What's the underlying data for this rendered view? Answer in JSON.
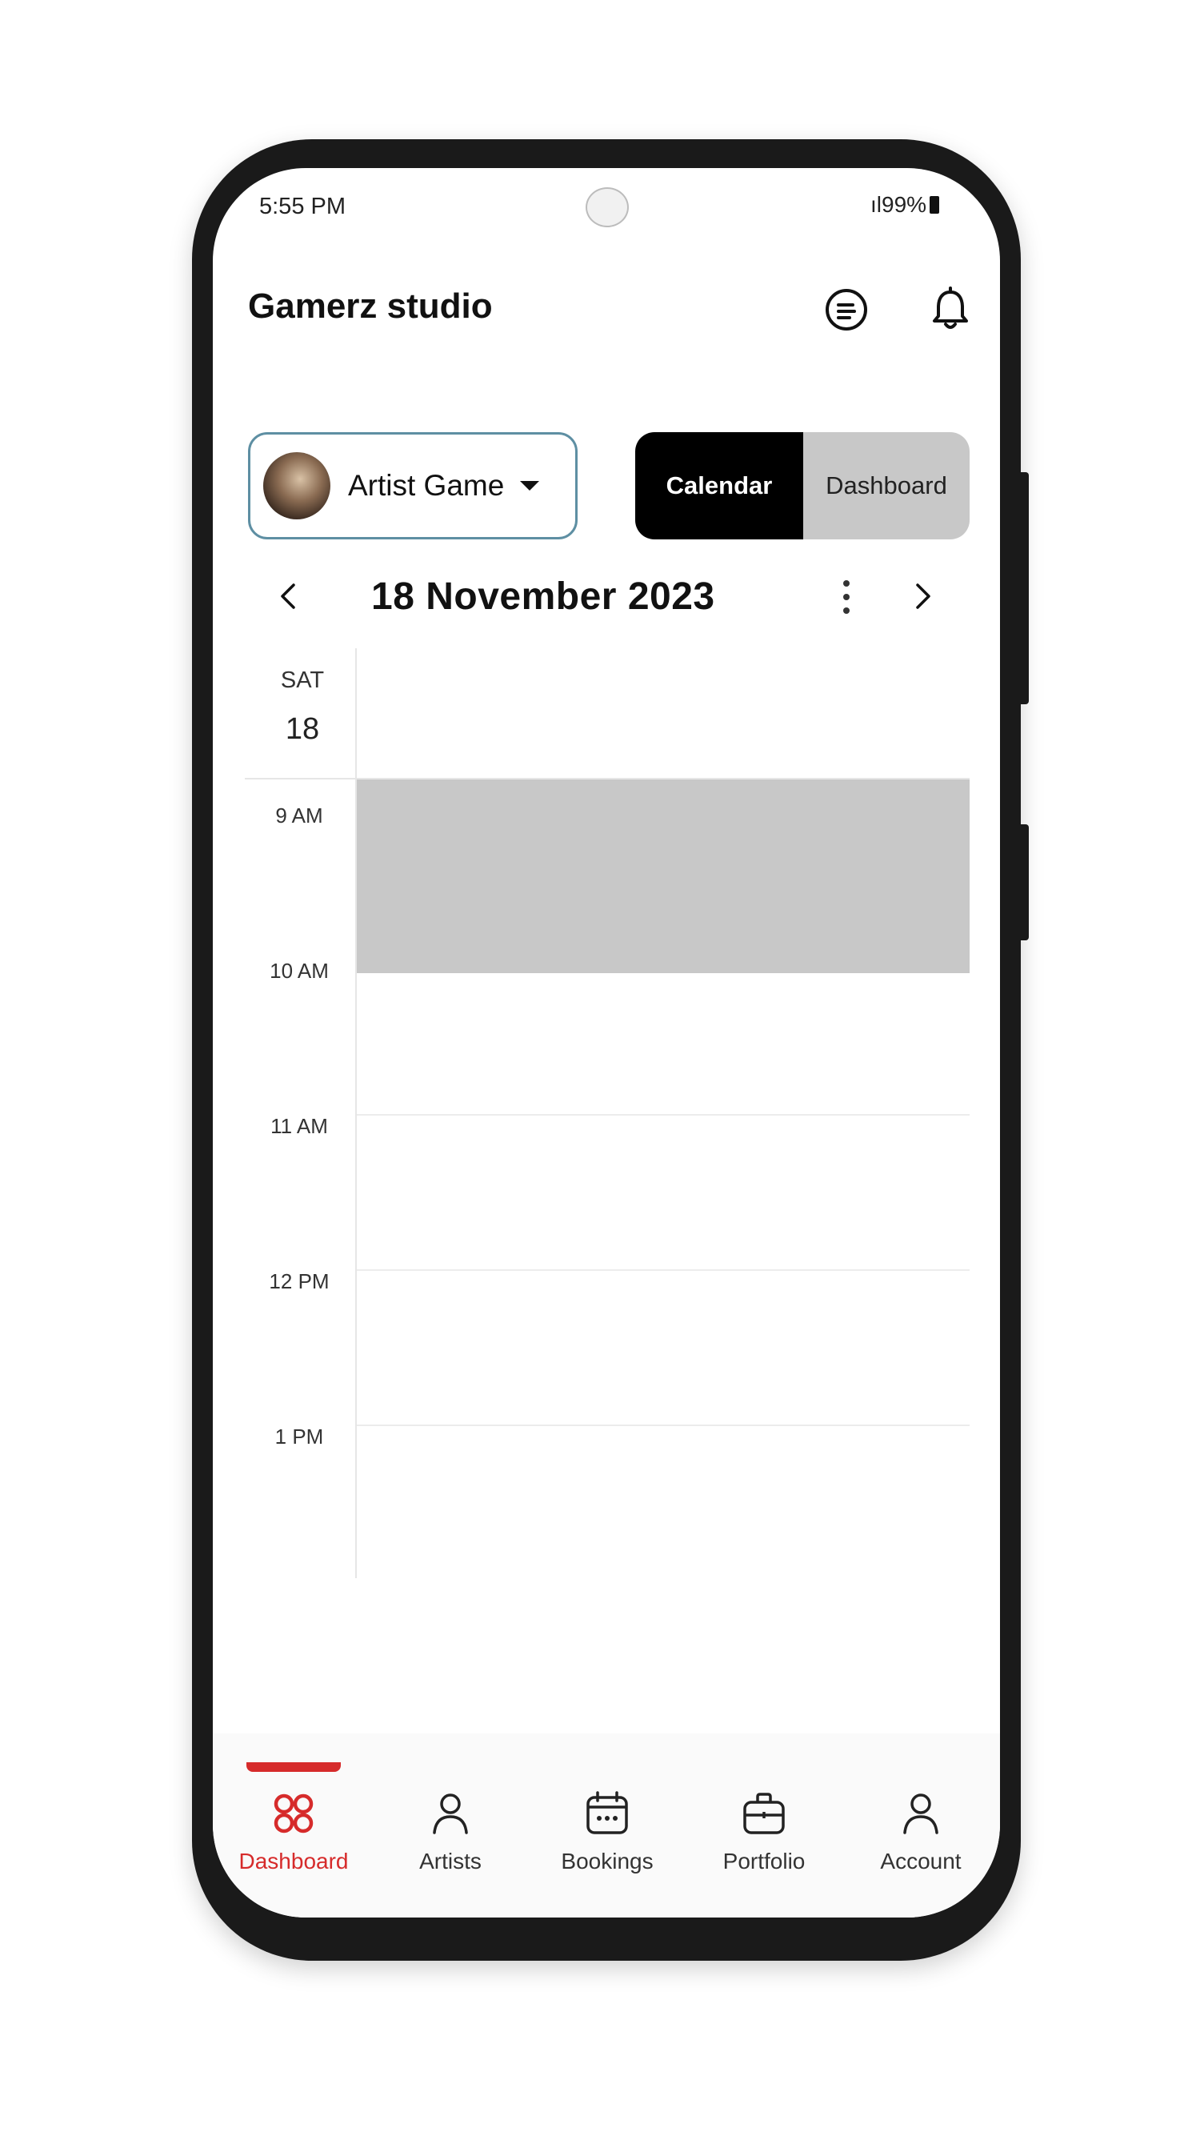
{
  "status_bar": {
    "time": "5:55 PM",
    "signal_battery": "ıl99%"
  },
  "header": {
    "title": "Gamerz studio"
  },
  "artist_selector": {
    "name": "Artist Game"
  },
  "view_toggle": {
    "calendar_label": "Calendar",
    "dashboard_label": "Dashboard",
    "selected": "Calendar"
  },
  "date_nav": {
    "date": "18 November 2023"
  },
  "calendar": {
    "day_label": "SAT",
    "day_number": "18",
    "hours": [
      "9 AM",
      "10 AM",
      "11 AM",
      "12 PM",
      "1 PM"
    ],
    "event_span": [
      "9 AM",
      "10 AM"
    ]
  },
  "bottom_nav": {
    "items": [
      {
        "label": "Dashboard",
        "icon": "grid-icon",
        "active": true
      },
      {
        "label": "Artists",
        "icon": "person-icon",
        "active": false
      },
      {
        "label": "Bookings",
        "icon": "calendar-icon",
        "active": false
      },
      {
        "label": "Portfolio",
        "icon": "briefcase-icon",
        "active": false
      },
      {
        "label": "Account",
        "icon": "account-icon",
        "active": false
      }
    ]
  },
  "colors": {
    "accent": "#d62b2b",
    "selector_border": "#5e8fa3",
    "event_block": "#c8c8c8",
    "toggle_active": "#000000"
  }
}
